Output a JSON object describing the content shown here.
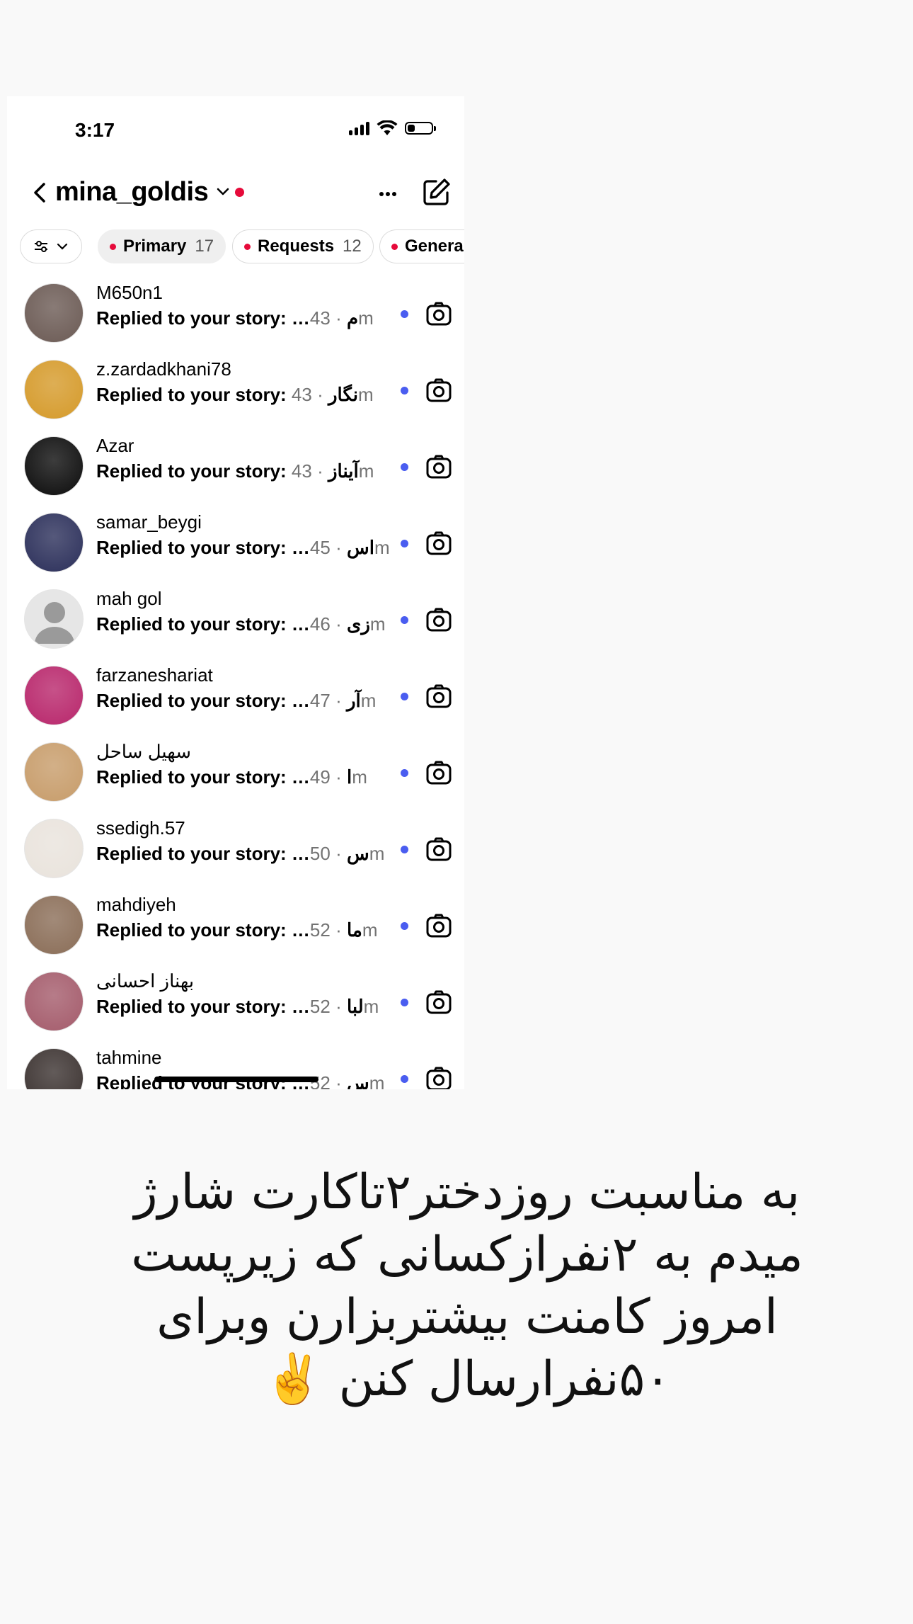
{
  "status_bar": {
    "time": "3:17",
    "battery_level": 0.3
  },
  "header": {
    "username": "mina_goldis"
  },
  "filters": [
    {
      "label": "Primary",
      "count": "17",
      "active": true
    },
    {
      "label": "Requests",
      "count": "12",
      "active": false
    },
    {
      "label": "General",
      "count": "",
      "active": false
    }
  ],
  "threads": [
    {
      "name": "M650n1",
      "preview": "Replied to your story: …م",
      "ago": "· 43m",
      "avatar_color": "#6b5a54"
    },
    {
      "name": "z.zardadkhani78",
      "preview": "Replied to your story: نگار",
      "ago": "· 43m",
      "avatar_color": "#d59a2a"
    },
    {
      "name": "Azar",
      "preview": "Replied to your story: آیناز",
      "ago": "· 43m",
      "avatar_color": "#0c0c0c"
    },
    {
      "name": "samar_beygi",
      "preview": "Replied to your story: …اس",
      "ago": "· 45m",
      "avatar_color": "#2b2f5a"
    },
    {
      "name": "mah gol",
      "preview": "Replied to your story: …زی",
      "ago": "· 46m",
      "avatar_color": "#e6e6e6"
    },
    {
      "name": "farzaneshariat",
      "preview": "Replied to your story: …آر",
      "ago": "· 47m",
      "avatar_color": "#b8266b"
    },
    {
      "name": "سهیل ساحل",
      "preview": "Replied to your story: …ا",
      "ago": "· 49m",
      "avatar_color": "#c79c6a"
    },
    {
      "name": "ssedigh.57",
      "preview": "Replied to your story: …س",
      "ago": "· 50m",
      "avatar_color": "#e9e3dc"
    },
    {
      "name": "mahdiyeh",
      "preview": "Replied to your story: …ما",
      "ago": "· 52m",
      "avatar_color": "#8a6d57"
    },
    {
      "name": "بهناز احسانی",
      "preview": "Replied to your story: …لبا",
      "ago": "· 52m",
      "avatar_color": "#a45b6b"
    },
    {
      "name": "tahmine",
      "preview": "Replied to your story: …س",
      "ago": "· 52m",
      "avatar_color": "#3b3230"
    }
  ],
  "caption": "به مناسبت روزدختر۲تاکارت شارژ میدم به ۲نفرازکسانی که زیرپست امروز کامنت بیشتربزارن وبرای ۵۰نفرارسال کنن ✌️"
}
